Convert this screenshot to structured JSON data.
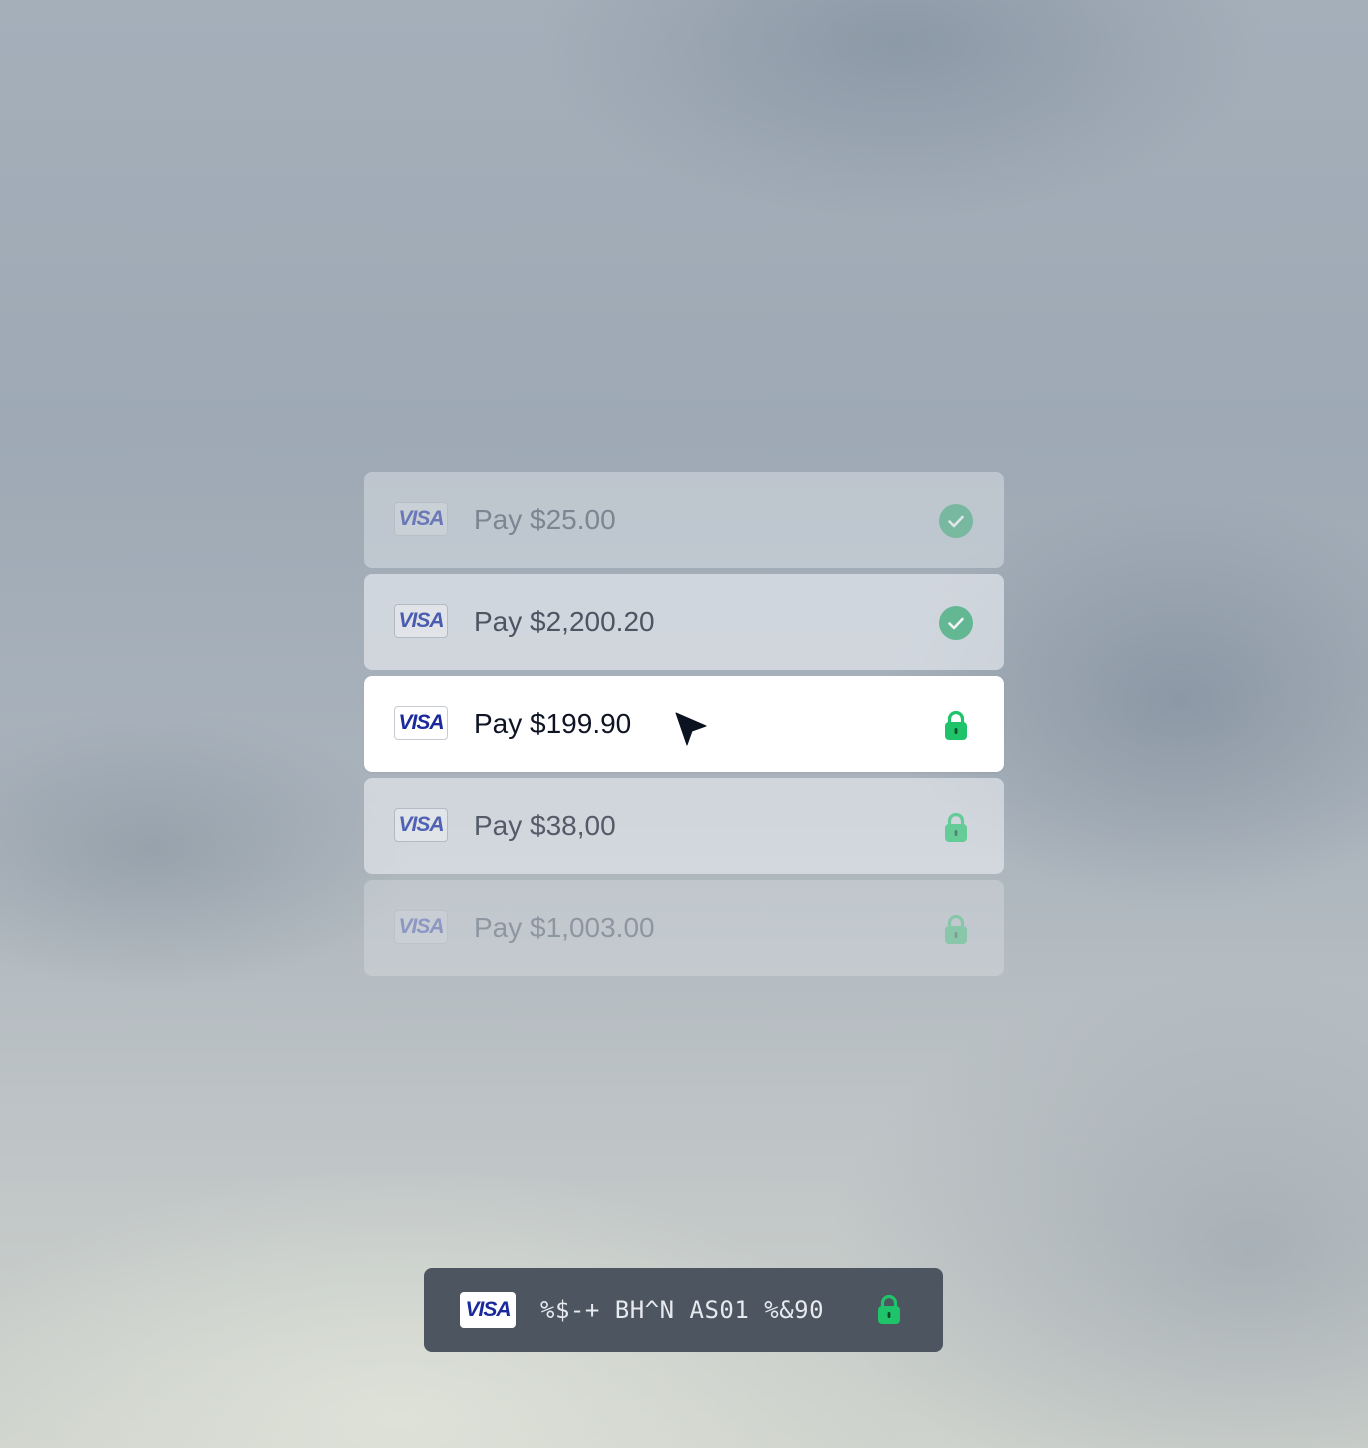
{
  "payments": [
    {
      "card_brand": "VISA",
      "label": "Pay $25.00",
      "status": "completed",
      "status_icon": "check-circle-icon"
    },
    {
      "card_brand": "VISA",
      "label": "Pay $2,200.20",
      "status": "completed",
      "status_icon": "check-circle-icon"
    },
    {
      "card_brand": "VISA",
      "label": "Pay $199.90",
      "status": "locked",
      "status_icon": "lock-icon"
    },
    {
      "card_brand": "VISA",
      "label": "Pay $38,00",
      "status": "locked",
      "status_icon": "lock-icon"
    },
    {
      "card_brand": "VISA",
      "label": "Pay $1,003.00",
      "status": "locked",
      "status_icon": "lock-icon"
    }
  ],
  "card_bar": {
    "card_brand": "VISA",
    "masked_number": "%$-+ BH^N AS01 %&90",
    "status_icon": "lock-icon"
  },
  "colors": {
    "visa_blue": "#1a2a9c",
    "success_green": "#1fc46a",
    "check_green": "#3fae7a",
    "bar_background": "#4c5560"
  }
}
